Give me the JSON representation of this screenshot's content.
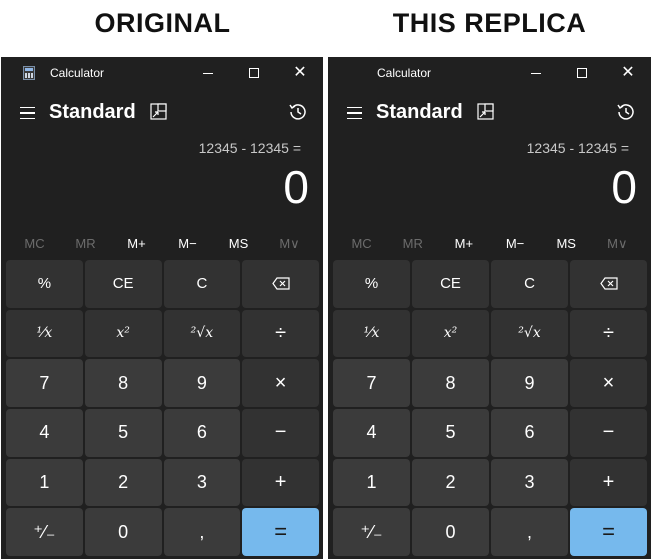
{
  "headings": {
    "left": "ORIGINAL",
    "right": "THIS REPLICA"
  },
  "window": {
    "title": "Calculator",
    "min": "",
    "close": "✕"
  },
  "header": {
    "mode": "Standard"
  },
  "display": {
    "expression": "12345 - 12345 =",
    "result": "0"
  },
  "memory": [
    "MC",
    "MR",
    "M+",
    "M−",
    "MS",
    "M∨"
  ],
  "keys": {
    "percent": "%",
    "ce": "CE",
    "c": "C",
    "reciprocal": "¹⁄x",
    "square": "x²",
    "sqrt": "²√x",
    "divide": "÷",
    "seven": "7",
    "eight": "8",
    "nine": "9",
    "multiply": "×",
    "four": "4",
    "five": "5",
    "six": "6",
    "minus": "−",
    "one": "1",
    "two": "2",
    "three": "3",
    "plus": "+",
    "negate": "⁺⁄₋",
    "zero": "0",
    "decimal": ",",
    "equals": "="
  },
  "colors": {
    "background": "#202020",
    "accent": "#76b9ed",
    "key_num": "#3b3b3b",
    "key_fn": "#323232"
  },
  "icons": [
    "calculator-app-icon",
    "hamburger-icon",
    "keep-on-top-icon",
    "history-icon",
    "backspace-icon"
  ]
}
